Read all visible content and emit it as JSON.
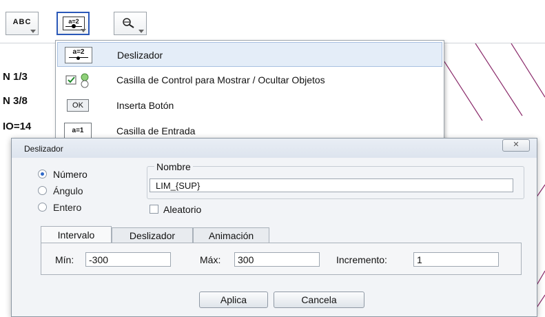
{
  "toolbar": {
    "text_tool_label": "ABC",
    "slider_tool_label": "a=2",
    "zoom_tool_icon": "magnifier-icon"
  },
  "canvas": {
    "fragments": [
      "N 1/3",
      "N 3/8",
      "IO=14"
    ]
  },
  "menu": {
    "items": [
      {
        "icon": "a=2",
        "label": "Deslizador"
      },
      {
        "icon": "checkbox-show-hide-icon",
        "label": "Casilla de Control para Mostrar / Ocultar Objetos"
      },
      {
        "icon": "OK",
        "label": "Inserta Botón"
      },
      {
        "icon": "a=1",
        "label": "Casilla de Entrada"
      }
    ]
  },
  "dialog": {
    "title": "Deslizador",
    "close_icon": "close-icon",
    "type_options": [
      {
        "label": "Número",
        "selected": true
      },
      {
        "label": "Ángulo",
        "selected": false
      },
      {
        "label": "Entero",
        "selected": false
      }
    ],
    "name_legend": "Nombre",
    "name_value": "LIM_{SUP}",
    "random_label": "Aleatorio",
    "tabs": [
      "Intervalo",
      "Deslizador",
      "Animación"
    ],
    "interval": {
      "min_label": "Mín:",
      "min_value": "-300",
      "max_label": "Máx:",
      "max_value": "300",
      "step_label": "Incremento:",
      "step_value": "1"
    },
    "apply_label": "Aplica",
    "cancel_label": "Cancela"
  }
}
